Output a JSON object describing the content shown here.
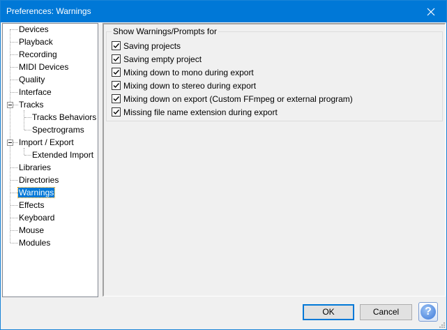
{
  "window": {
    "title": "Preferences: Warnings"
  },
  "tree": {
    "items": [
      {
        "label": "Devices"
      },
      {
        "label": "Playback"
      },
      {
        "label": "Recording"
      },
      {
        "label": "MIDI Devices"
      },
      {
        "label": "Quality"
      },
      {
        "label": "Interface"
      },
      {
        "label": "Tracks"
      },
      {
        "label": "Tracks Behaviors"
      },
      {
        "label": "Spectrograms"
      },
      {
        "label": "Import / Export"
      },
      {
        "label": "Extended Import"
      },
      {
        "label": "Libraries"
      },
      {
        "label": "Directories"
      },
      {
        "label": "Warnings"
      },
      {
        "label": "Effects"
      },
      {
        "label": "Keyboard"
      },
      {
        "label": "Mouse"
      },
      {
        "label": "Modules"
      }
    ],
    "selected": "Warnings"
  },
  "warnings": {
    "group_label": "Show Warnings/Prompts for",
    "options": [
      {
        "label": "Saving projects",
        "checked": true
      },
      {
        "label": "Saving empty project",
        "checked": true
      },
      {
        "label": "Mixing down to mono during export",
        "checked": true
      },
      {
        "label": "Mixing down to stereo during export",
        "checked": true
      },
      {
        "label": "Mixing down on export (Custom FFmpeg or external program)",
        "checked": true
      },
      {
        "label": "Missing file name extension during export",
        "checked": true
      }
    ]
  },
  "buttons": {
    "ok": "OK",
    "cancel": "Cancel",
    "help": "?"
  },
  "colors": {
    "titlebar": "#0078d7",
    "selection": "#0078d7"
  }
}
